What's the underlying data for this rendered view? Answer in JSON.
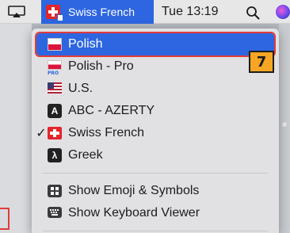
{
  "menubar": {
    "input_source": "Swiss French",
    "clock": "Tue 13:19",
    "icons": [
      "airplay-icon",
      "swiss-flag-icon",
      "search-icon",
      "siri-icon"
    ]
  },
  "menu": {
    "items": [
      {
        "label": "Polish",
        "icon": "polish-flag-icon",
        "selected": true
      },
      {
        "label": "Polish - Pro",
        "icon": "polish-pro-flag-icon",
        "badge": "PRO"
      },
      {
        "label": "U.S.",
        "icon": "us-flag-icon"
      },
      {
        "label": "ABC - AZERTY",
        "icon": "abc-key-icon",
        "key_glyph": "A"
      },
      {
        "label": "Swiss French",
        "icon": "swiss-flag-icon",
        "checked": true,
        "check_glyph": "✓"
      },
      {
        "label": "Greek",
        "icon": "greek-key-icon",
        "key_glyph": "λ"
      }
    ],
    "extras": [
      {
        "label": "Show Emoji & Symbols",
        "icon": "emoji-symbols-icon"
      },
      {
        "label": "Show Keyboard Viewer",
        "icon": "keyboard-viewer-icon"
      }
    ]
  },
  "annotation": {
    "step_number": "7"
  },
  "colors": {
    "accent": "#2d66e0",
    "highlight_outline": "#e23b3b",
    "badge": "#f6a623",
    "menu_bg": "#e1e1e3"
  }
}
